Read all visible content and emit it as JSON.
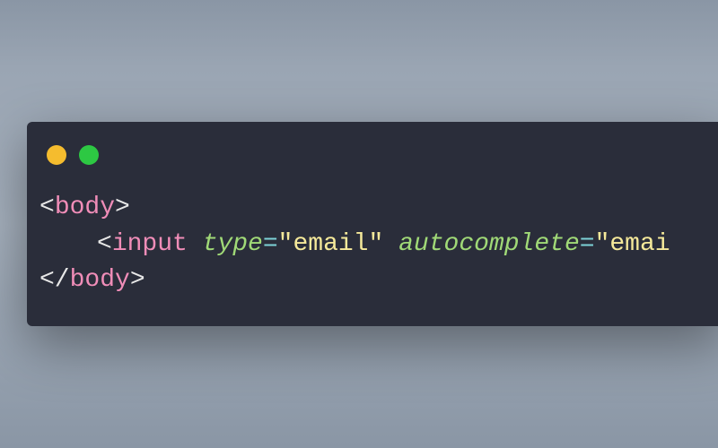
{
  "code": {
    "line1": {
      "open_bracket": "<",
      "tag": "body",
      "close_bracket": ">"
    },
    "line2": {
      "open_bracket": "<",
      "tag": "input",
      "attr1": "type",
      "eq1": "=",
      "val1": "\"email\"",
      "attr2": "autocomplete",
      "eq2": "=",
      "val2": "\"emai"
    },
    "line3": {
      "open_bracket": "</",
      "tag": "body",
      "close_bracket": ">"
    }
  },
  "colors": {
    "window_bg": "#2a2d3a",
    "dot_yellow": "#f5bc2e",
    "dot_green": "#2dc843",
    "bracket": "#e8e8e8",
    "tag": "#f08db8",
    "attr": "#a0d977",
    "string": "#f5e99a",
    "equals": "#7dd3d8"
  }
}
